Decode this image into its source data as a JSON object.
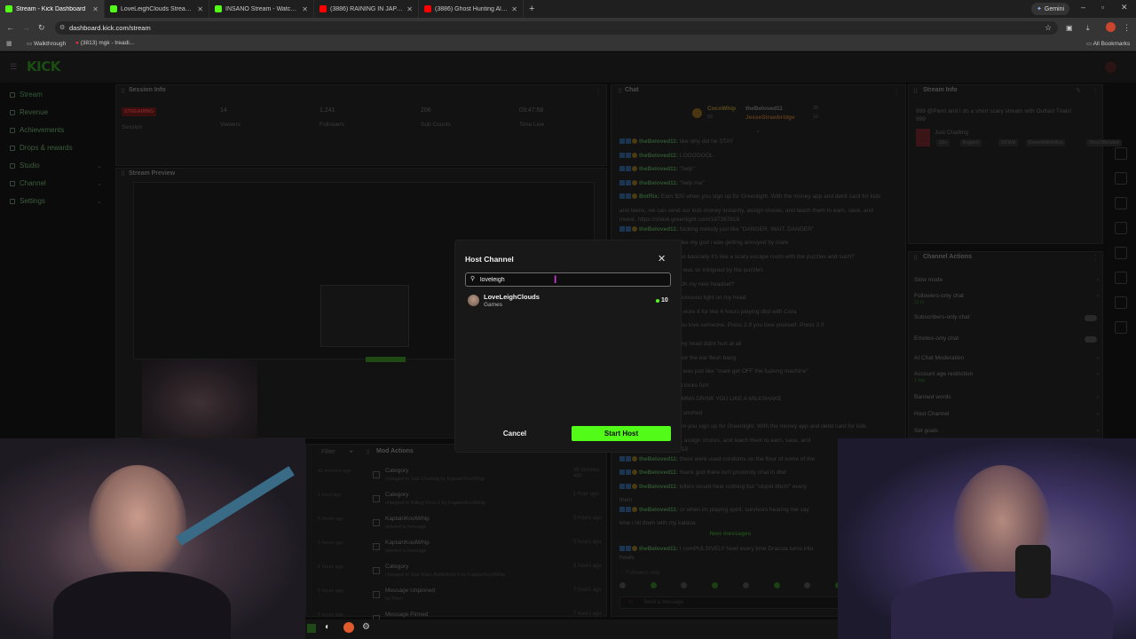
{
  "browser": {
    "tabs": [
      {
        "title": "Stream - Kick Dashboard",
        "color": "#53fc18",
        "active": true
      },
      {
        "title": "LoveLeighClouds Stream - Wat",
        "color": "#53fc18"
      },
      {
        "title": "INSANO Stream - Watch Live o",
        "color": "#53fc18"
      },
      {
        "title": "(3886) RAINING IN JAPAN",
        "color": "#ff0000"
      },
      {
        "title": "(3886) Ghost Hunting Alone Fo",
        "color": "#ff0000"
      }
    ],
    "new_tab": "+",
    "gemini": "Gemini",
    "url": "dashboard.kick.com/stream",
    "bookmarks": [
      "Walkthrough",
      "(3813) mgk - treadi..."
    ],
    "all_bookmarks": "All Bookmarks"
  },
  "kick": {
    "logo": "KICK"
  },
  "sidebar": {
    "items": [
      {
        "label": "Stream",
        "chevron": false
      },
      {
        "label": "Revenue",
        "chevron": false
      },
      {
        "label": "Achievements",
        "chevron": false
      },
      {
        "label": "Drops & rewards",
        "chevron": false
      },
      {
        "label": "Studio",
        "chevron": true
      },
      {
        "label": "Channel",
        "chevron": true
      },
      {
        "label": "Settings",
        "chevron": true
      }
    ]
  },
  "session": {
    "title": "Session Info",
    "badge": "STREAMING",
    "badge_sub": "Session",
    "stats": [
      {
        "value": "14",
        "label": "Viewers"
      },
      {
        "value": "1,241",
        "label": "Followers"
      },
      {
        "value": "206",
        "label": "Sub Counts"
      },
      {
        "value": "03:47:58",
        "label": "Time Live"
      }
    ]
  },
  "preview": {
    "title": "Stream Preview"
  },
  "chat": {
    "title": "Chat",
    "pinned": [
      {
        "user": "CocoWhip",
        "sub": "50"
      },
      {
        "user": "theBeloved11",
        "sub": "25"
      },
      {
        "user": "JesseStrawbridge",
        "sub": "10"
      }
    ],
    "lines": [
      {
        "user": "theBeloved11:",
        "text": "like why did he STAY"
      },
      {
        "user": "theBeloved11:",
        "text": "LOOOOOOL"
      },
      {
        "user": "theBeloved11:",
        "text": "\"help\""
      },
      {
        "user": "theBeloved11:",
        "text": "\"help me\""
      },
      {
        "user": "BotRix:",
        "text": "Earn $30 when you sign up for Greenlight. With the money app and debit card for kids"
      },
      {
        "user": "",
        "text": "and teens, we can send our kids money instantly, assign chores, and teach them to earn, save, and"
      },
      {
        "user": "",
        "text": "invest. https://share.greenlight.com/187387818"
      },
      {
        "user": "theBeloved11:",
        "text": "fucking melody just like \"DANGER. WAIT. DANGER\""
      },
      {
        "user": "theBeloved11:",
        "text": "like my god i was getting annoyed by mark"
      },
      {
        "user": "theBeloved11:",
        "text": "so basically it's like a scary escape room with the puzzles and such?"
      },
      {
        "user": "theBeloved11:",
        "text": "I was so intrigued by the puzzles"
      },
      {
        "user": "theBeloved11:",
        "text": "Oh my new headset?"
      },
      {
        "user": "theBeloved11:",
        "text": "soooooo light on my head"
      },
      {
        "user": "theBeloved11:",
        "text": "I wore it for like 4 hours playing dbd with Cora"
      },
      {
        "user": "",
        "text": "Hey you...... Press 1 if you love someone. Press 2 if you love yourself. Press 3 if"
      },
      {
        "user": "",
        "text": "all"
      },
      {
        "user": "theBeloved11:",
        "text": "my head didnt hurt at all"
      },
      {
        "user": "theBeloved11:",
        "text": "nor the ear flesh bang"
      },
      {
        "user": "theBeloved11:",
        "text": "I was just like \"mark get OFF the fucking machine\""
      },
      {
        "user": "theBeloved11:",
        "text": "it looks fun!"
      },
      {
        "user": "theBeloved11:",
        "text": "IMMA DRINK YOU LIKE A MILKSHAKE"
      },
      {
        "user": "theBeloved11:",
        "text": "I snorted"
      },
      {
        "user": "BotRix:",
        "text": "$30 when you sign up for Greenlight. With the money app and debit card for kids"
      },
      {
        "user": "",
        "text": "our kids money instantly, assign chores, and teach them to earn, save, and"
      },
      {
        "user": "",
        "text": "greenlight.com/187387818"
      },
      {
        "user": "theBeloved11:",
        "text": "there were used condoms on the floor of some of the"
      },
      {
        "user": "theBeloved11:",
        "text": "thank god there isn't proximity chat in dbd"
      },
      {
        "user": "theBeloved11:",
        "text": "killers would hear nothing but \"stupid bitch!\" every"
      },
      {
        "user": "",
        "text": "them"
      },
      {
        "user": "theBeloved11:",
        "text": "or when im playing spirit, survivors hearing me say"
      },
      {
        "user": "",
        "text": "time i hit them with my katana"
      }
    ],
    "new_messages": "New messages",
    "last_line": {
      "user": "theBeloved11:",
      "text": "I comPULSIVELY howl every time Dracula turns into"
    },
    "last_line_2": "howls",
    "followers_only": "Followers only",
    "input_placeholder": "Send a message"
  },
  "stream_info": {
    "title": "Stream Info",
    "stream_title": "999 @Pierri and I do a short scary stream with Outlast Trials!",
    "stream_title_2": "999",
    "category": "Just Chatting",
    "tags": [
      "18+",
      "English",
      "OFWA",
      "DoesntWorkBut",
      "StayOffended"
    ]
  },
  "channel_actions": {
    "title": "Channel Actions",
    "items": [
      {
        "label": "Slow mode",
        "sub": ""
      },
      {
        "label": "Followers-only chat",
        "sub": "12 hr"
      },
      {
        "label": "Subscribers-only chat",
        "sub": ""
      },
      {
        "label": "Emotes-only chat",
        "sub": ""
      },
      {
        "label": "AI Chat Moderation",
        "sub": ""
      },
      {
        "label": "Account age restriction",
        "sub": "1 day"
      },
      {
        "label": "Banned words",
        "sub": ""
      },
      {
        "label": "Host Channel",
        "sub": ""
      },
      {
        "label": "Set goals",
        "sub": ""
      }
    ]
  },
  "mod_actions": {
    "filter": "Filter",
    "title": "Mod Actions",
    "left_times": [
      "41 minutes ago",
      "1 hour ago",
      "5 hours ago",
      "5 hours ago",
      "5 hours ago",
      "5 hours ago",
      "5 hours ago"
    ],
    "rows": [
      {
        "title": "Category",
        "desc": "changed to Just Chatting by KaptainKoolWhip",
        "time": "36 minutes ago"
      },
      {
        "title": "Category",
        "desc": "changed to Killing Floor 3 by KaptainKoolWhip",
        "time": "1 hour ago"
      },
      {
        "title": "KaptainKoolWhip",
        "desc": "deleted a message",
        "time": "5 hours ago"
      },
      {
        "title": "KaptainKoolWhip",
        "desc": "deleted a message",
        "time": "5 hours ago"
      },
      {
        "title": "Category",
        "desc": "changed to Star Wars Battlefront II by KaptainKoolWhip",
        "time": "5 hours ago"
      },
      {
        "title": "Message Unpinned",
        "desc": "by Pierri",
        "time": "7 hours ago"
      },
      {
        "title": "Message Pinned",
        "desc": "",
        "time": "7 hours ago"
      }
    ]
  },
  "modal": {
    "title": "Host Channel",
    "search_value": "loveleigh",
    "result": {
      "name": "LoveLeighClouds",
      "category": "Games",
      "viewers": "10"
    },
    "cancel": "Cancel",
    "start": "Start Host"
  },
  "colors": {
    "accent": "#53fc18",
    "modal_bg": "#181818"
  }
}
